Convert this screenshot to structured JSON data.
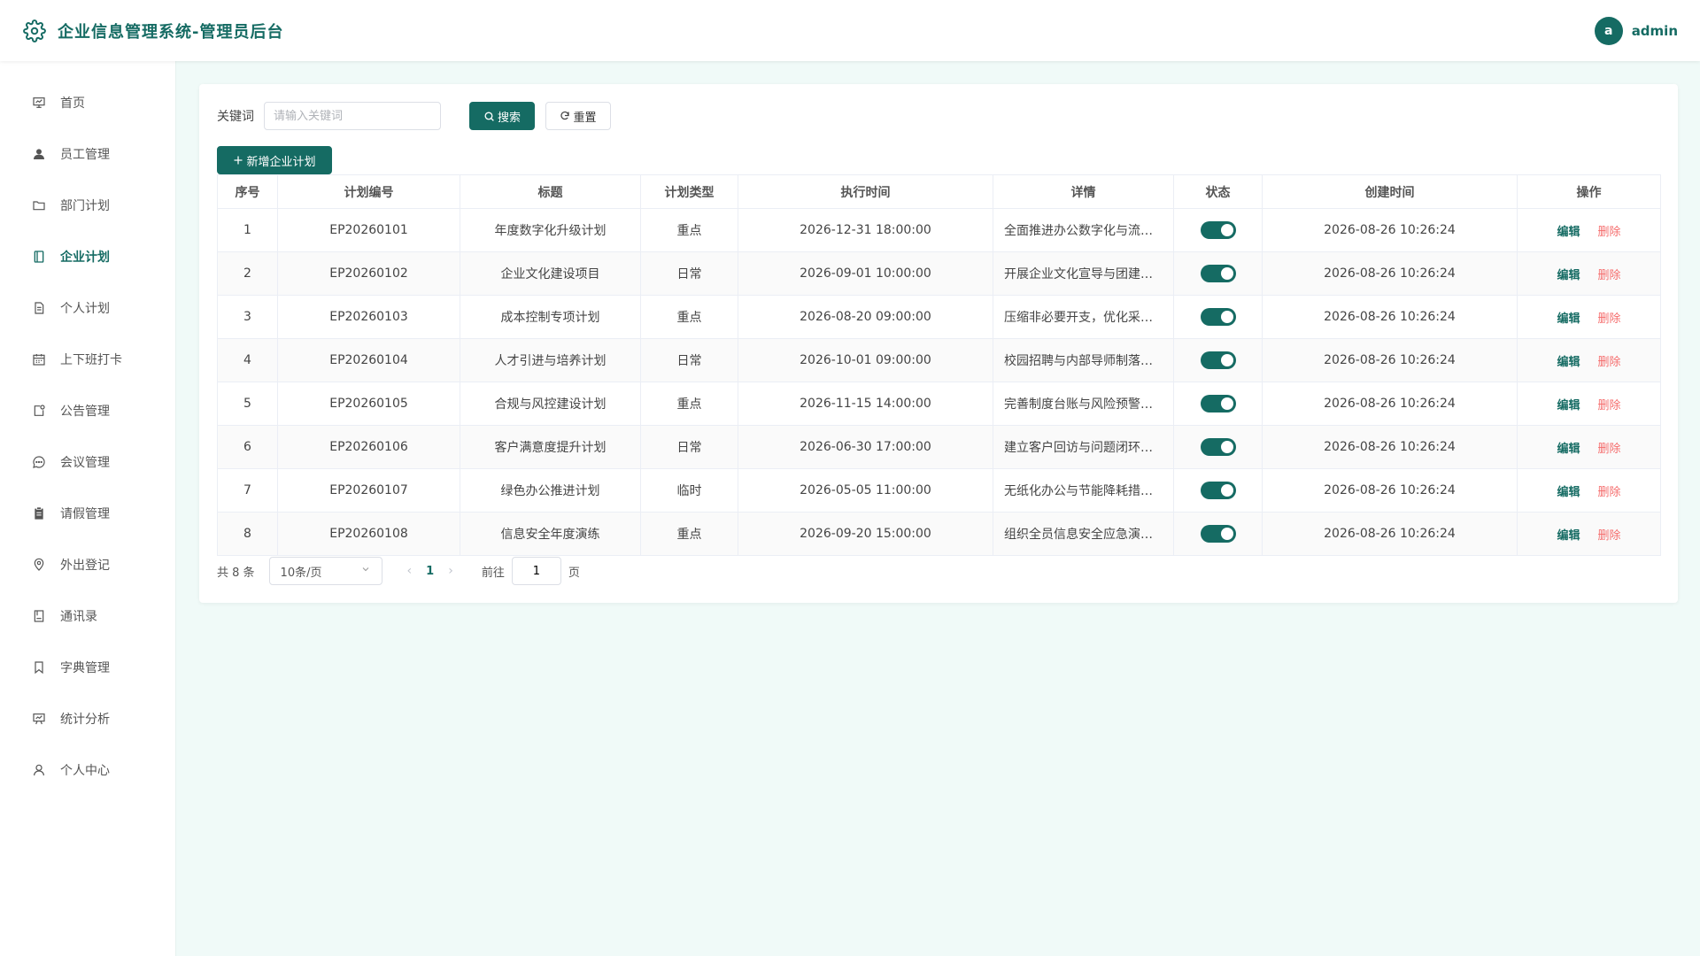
{
  "header": {
    "title": "企业信息管理系统-管理员后台",
    "avatar_letter": "a",
    "username": "admin"
  },
  "sidebar": {
    "items": [
      {
        "label": "首页",
        "icon": "presentation-icon"
      },
      {
        "label": "员工管理",
        "icon": "user-icon"
      },
      {
        "label": "部门计划",
        "icon": "folder-icon"
      },
      {
        "label": "企业计划",
        "icon": "notebook-icon",
        "active": true
      },
      {
        "label": "个人计划",
        "icon": "document-icon"
      },
      {
        "label": "上下班打卡",
        "icon": "calendar-icon"
      },
      {
        "label": "公告管理",
        "icon": "notice-icon"
      },
      {
        "label": "会议管理",
        "icon": "chat-bubble-icon"
      },
      {
        "label": "请假管理",
        "icon": "clipboard-icon"
      },
      {
        "label": "外出登记",
        "icon": "location-pin-icon"
      },
      {
        "label": "通讯录",
        "icon": "contact-book-icon"
      },
      {
        "label": "字典管理",
        "icon": "bookmark-icon"
      },
      {
        "label": "统计分析",
        "icon": "chart-board-icon"
      },
      {
        "label": "个人中心",
        "icon": "user-outline-icon"
      }
    ]
  },
  "search": {
    "label": "关键词",
    "placeholder": "请输入关键词",
    "value": "",
    "search_label": "搜索",
    "reset_label": "重置"
  },
  "add_button": {
    "label": "新增企业计划"
  },
  "table": {
    "columns": [
      "序号",
      "计划编号",
      "标题",
      "计划类型",
      "执行时间",
      "详情",
      "状态",
      "创建时间",
      "操作"
    ],
    "edit_label": "编辑",
    "delete_label": "删除",
    "rows": [
      {
        "index": "1",
        "code": "EP20260101",
        "title": "年度数字化升级计划",
        "type": "重点",
        "exec_time": "2026-12-31 18:00:00",
        "detail": "全面推进办公数字化与流…",
        "status": true,
        "created": "2026-08-26 10:26:24"
      },
      {
        "index": "2",
        "code": "EP20260102",
        "title": "企业文化建设项目",
        "type": "日常",
        "exec_time": "2026-09-01 10:00:00",
        "detail": "开展企业文化宣导与团建…",
        "status": true,
        "created": "2026-08-26 10:26:24"
      },
      {
        "index": "3",
        "code": "EP20260103",
        "title": "成本控制专项计划",
        "type": "重点",
        "exec_time": "2026-08-20 09:00:00",
        "detail": "压缩非必要开支，优化采…",
        "status": true,
        "created": "2026-08-26 10:26:24"
      },
      {
        "index": "4",
        "code": "EP20260104",
        "title": "人才引进与培养计划",
        "type": "日常",
        "exec_time": "2026-10-01 09:00:00",
        "detail": "校园招聘与内部导师制落…",
        "status": true,
        "created": "2026-08-26 10:26:24"
      },
      {
        "index": "5",
        "code": "EP20260105",
        "title": "合规与风控建设计划",
        "type": "重点",
        "exec_time": "2026-11-15 14:00:00",
        "detail": "完善制度台账与风险预警…",
        "status": true,
        "created": "2026-08-26 10:26:24"
      },
      {
        "index": "6",
        "code": "EP20260106",
        "title": "客户满意度提升计划",
        "type": "日常",
        "exec_time": "2026-06-30 17:00:00",
        "detail": "建立客户回访与问题闭环…",
        "status": true,
        "created": "2026-08-26 10:26:24"
      },
      {
        "index": "7",
        "code": "EP20260107",
        "title": "绿色办公推进计划",
        "type": "临时",
        "exec_time": "2026-05-05 11:00:00",
        "detail": "无纸化办公与节能降耗措…",
        "status": true,
        "created": "2026-08-26 10:26:24"
      },
      {
        "index": "8",
        "code": "EP20260108",
        "title": "信息安全年度演练",
        "type": "重点",
        "exec_time": "2026-09-20 15:00:00",
        "detail": "组织全员信息安全应急演…",
        "status": true,
        "created": "2026-08-26 10:26:24"
      }
    ]
  },
  "pagination": {
    "total_text": "共 8 条",
    "page_size": "10条/页",
    "current_page": "1",
    "goto_label": "前往",
    "goto_value": "1",
    "page_suffix": "页"
  },
  "colors": {
    "primary": "#156b63",
    "danger": "#f56c6c",
    "background": "#f0faf8"
  }
}
